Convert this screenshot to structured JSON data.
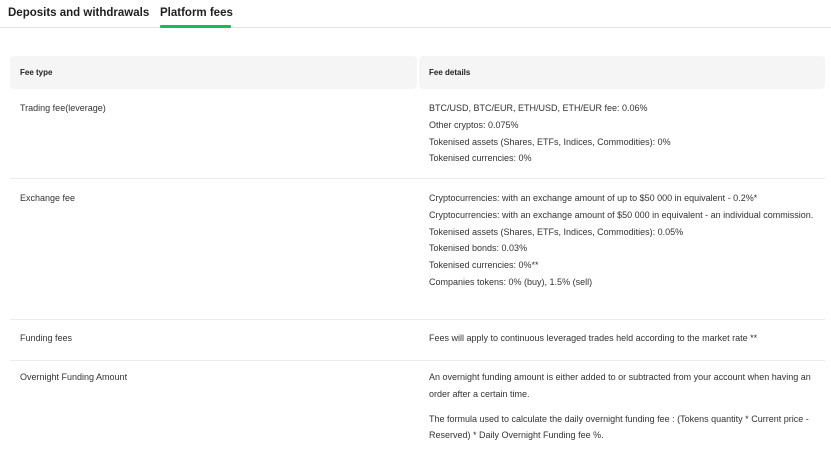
{
  "tabs": {
    "deposits": "Deposits and withdrawals",
    "platform": "Platform fees"
  },
  "accent_color": "#1db954",
  "table": {
    "headers": [
      "Fee type",
      "Fee details"
    ],
    "rows": [
      {
        "type": "Trading fee(leverage)",
        "details": [
          "BTC/USD, BTC/EUR, ETH/USD, ETH/EUR fee: 0.06%",
          "Other cryptos: 0.075%",
          "Tokenised assets (Shares, ETFs, Indices, Commodities): 0%",
          "Tokenised currencies: 0%"
        ]
      },
      {
        "type": "Exchange fee",
        "details": [
          "Cryptocurrencies: with an exchange amount of up to $50 000 in equivalent - 0.2%*",
          "Cryptocurrencies: with an exchange amount of $50 000 in equivalent - an individual commission.",
          "Tokenised assets (Shares, ETFs, Indices, Commodities): 0.05%",
          "Tokenised bonds: 0.03%",
          "Tokenised currencies: 0%**",
          "Companies tokens: 0% (buy), 1.5% (sell)"
        ]
      },
      {
        "type": "Funding fees",
        "details": [
          "Fees will apply to continuous leveraged trades held according to the market rate **"
        ]
      },
      {
        "type": "Overnight Funding Amount",
        "details": [
          "An overnight funding amount is either added to or subtracted from your account when having an order after a certain time.",
          "The formula used to calculate the daily overnight funding fee : (Tokens quantity * Current price - Reserved) * Daily Overnight Funding fee %."
        ]
      }
    ]
  }
}
